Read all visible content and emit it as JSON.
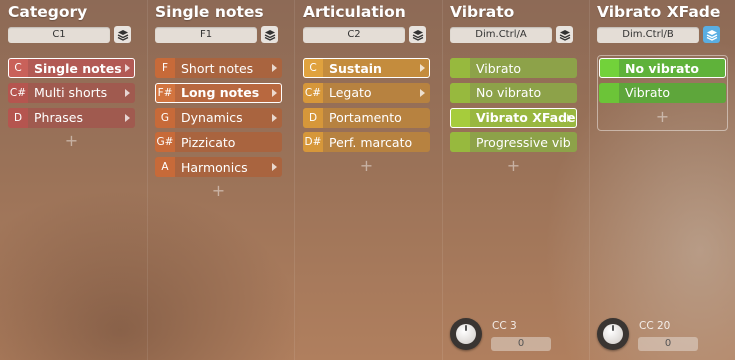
{
  "columns": [
    {
      "title": "Category",
      "selector": "C1",
      "layer_active": false,
      "colors": {
        "key": "#b5554f",
        "row": "#a05a4f",
        "sel_key": "#c9615a",
        "sel_row": "#b25a55"
      },
      "items": [
        {
          "key": "C",
          "label": "Single notes",
          "selected": true,
          "arrow": true
        },
        {
          "key": "C#",
          "label": "Multi shorts",
          "selected": false,
          "arrow": true
        },
        {
          "key": "D",
          "label": "Phrases",
          "selected": false,
          "arrow": true
        }
      ]
    },
    {
      "title": "Single notes",
      "selector": "F1",
      "layer_active": false,
      "colors": {
        "key": "#c76a39",
        "row": "#a9643f",
        "sel_key": "#d2743f",
        "sel_row": "#b8683f"
      },
      "items": [
        {
          "key": "F",
          "label": "Short notes",
          "selected": false,
          "arrow": true
        },
        {
          "key": "F#",
          "label": "Long notes",
          "selected": true,
          "arrow": true
        },
        {
          "key": "G",
          "label": "Dynamics",
          "selected": false,
          "arrow": true
        },
        {
          "key": "G#",
          "label": "Pizzicato",
          "selected": false,
          "arrow": false
        },
        {
          "key": "A",
          "label": "Harmonics",
          "selected": false,
          "arrow": true
        }
      ]
    },
    {
      "title": "Articulation",
      "selector": "C2",
      "layer_active": false,
      "colors": {
        "key": "#d6973a",
        "row": "#b78240",
        "sel_key": "#e0a23e",
        "sel_row": "#c48c3d"
      },
      "items": [
        {
          "key": "C",
          "label": "Sustain",
          "selected": true,
          "arrow": true
        },
        {
          "key": "C#",
          "label": "Legato",
          "selected": false,
          "arrow": true
        },
        {
          "key": "D",
          "label": "Portamento",
          "selected": false,
          "arrow": false
        },
        {
          "key": "D#",
          "label": "Perf. marcato",
          "selected": false,
          "arrow": false
        }
      ]
    },
    {
      "title": "Vibrato",
      "selector": "Dim.Ctrl/A",
      "layer_active": false,
      "colors": {
        "key": "#97b93e",
        "row": "#8da249",
        "sel_key": "#a6cc3c",
        "sel_row": "#99b740"
      },
      "items": [
        {
          "key": "",
          "label": "Vibrato",
          "selected": false,
          "arrow": false
        },
        {
          "key": "",
          "label": "No vibrato",
          "selected": false,
          "arrow": false
        },
        {
          "key": "",
          "label": "Vibrato XFade",
          "selected": true,
          "arrow": true
        },
        {
          "key": "",
          "label": "Progressive vib",
          "selected": false,
          "arrow": false
        }
      ],
      "knob": {
        "label": "CC 3",
        "value": "0"
      }
    },
    {
      "title": "Vibrato XFade",
      "selector": "Dim.Ctrl/B",
      "layer_active": true,
      "colors": {
        "key": "#6cc438",
        "row": "#5ea63b",
        "sel_key": "#72d23a",
        "sel_row": "#5fb23a"
      },
      "items": [
        {
          "key": "",
          "label": "No vibrato",
          "selected": true,
          "arrow": false
        },
        {
          "key": "",
          "label": "Vibrato",
          "selected": false,
          "arrow": false
        }
      ],
      "boxed": true,
      "knob": {
        "label": "CC 20",
        "value": "0"
      }
    }
  ],
  "add_symbol": "+",
  "icons": {
    "layer": "layers-icon",
    "arrow": "chevron-right-icon",
    "knob": "knob-icon"
  }
}
